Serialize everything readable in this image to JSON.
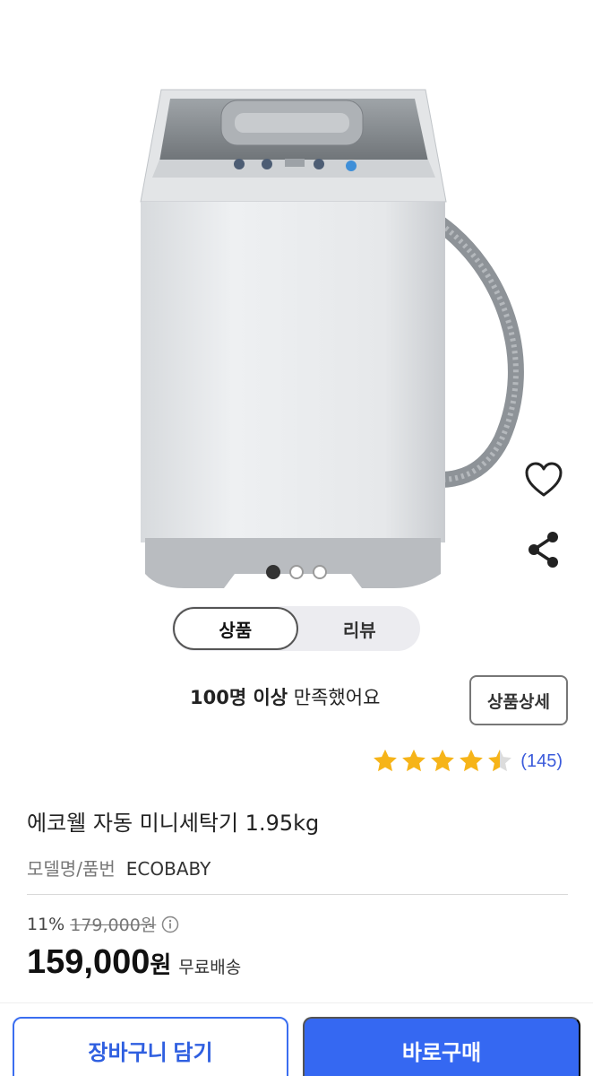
{
  "gallery": {
    "active_index": 0,
    "total": 3
  },
  "tabs": [
    {
      "label": "상품",
      "active": true
    },
    {
      "label": "리뷰",
      "active": false
    }
  ],
  "satisfaction": {
    "bold": "100명 이상",
    "rest": " 만족했어요"
  },
  "detail_button": "상품상세",
  "rating": {
    "stars": 4.5,
    "count": "(145)"
  },
  "product": {
    "title": "에코웰 자동 미니세탁기 1.95kg",
    "model_label": "모델명/품번",
    "model_value": "ECOBABY"
  },
  "price": {
    "discount": "11%",
    "original": "179,000원",
    "sale": "159,000",
    "currency": "원",
    "shipping": "무료배송"
  },
  "buttons": {
    "cart": "장바구니 담기",
    "buy": "바로구매"
  },
  "colors": {
    "accent": "#3568f2",
    "star": "#f6b419",
    "link": "#3b5bdb"
  },
  "icons": {
    "wishlist": "heart-outline-icon",
    "share": "share-icon",
    "info": "info-icon"
  }
}
